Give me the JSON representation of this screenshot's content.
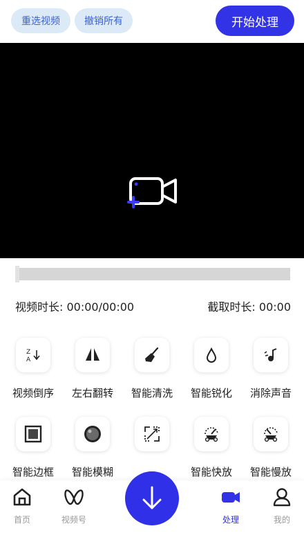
{
  "header": {
    "reselect_label": "重选视频",
    "undo_label": "撤销所有",
    "start_label": "开始处理"
  },
  "info": {
    "video_duration": "视频时长: 00:00/00:00",
    "clip_duration": "截取时长: 00:00"
  },
  "tools": [
    {
      "label": "视频倒序",
      "icon": "sort-reverse-icon"
    },
    {
      "label": "左右翻转",
      "icon": "flip-horizontal-icon"
    },
    {
      "label": "智能清洗",
      "icon": "broom-icon"
    },
    {
      "label": "智能锐化",
      "icon": "water-drop-icon"
    },
    {
      "label": "消除声音",
      "icon": "mute-note-icon"
    },
    {
      "label": "智能边框",
      "icon": "frame-icon"
    },
    {
      "label": "智能模糊",
      "icon": "blur-circle-icon"
    },
    {
      "label": "",
      "icon": "resize-icon"
    },
    {
      "label": "智能快放",
      "icon": "fast-speed-icon"
    },
    {
      "label": "智能慢放",
      "icon": "slow-speed-icon"
    }
  ],
  "tabbar": {
    "home": "首页",
    "channels": "视频号",
    "process": "处理",
    "mine": "我的"
  },
  "colors": {
    "accent": "#3232e6",
    "pill_bg": "#dce9f7",
    "pill_text": "#3a63d6"
  }
}
